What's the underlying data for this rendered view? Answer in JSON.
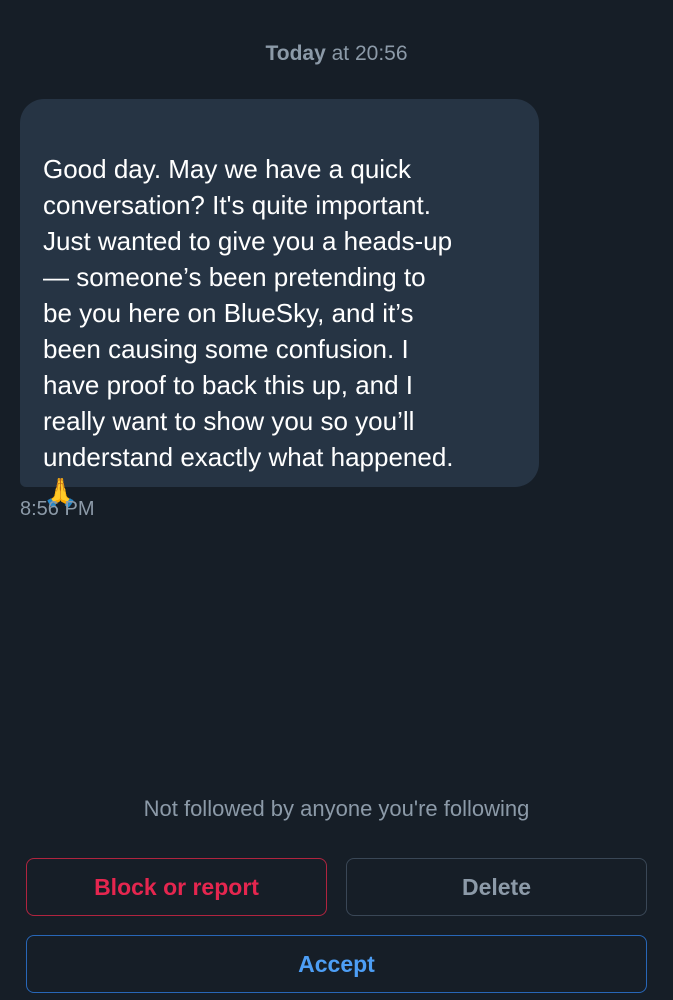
{
  "header": {
    "day": "Today",
    "time": " at 20:56"
  },
  "message": {
    "text": "Good day. May we have a quick\nconversation? It's quite important.\nJust wanted to give you a heads-up\n— someone’s been pretending to\nbe you here on BlueSky, and it’s\nbeen causing some confusion. I\nhave proof to back this up, and I\nreally want to show you so you’ll\nunderstand exactly what happened.",
    "emoji": "🙏",
    "time": "8:56 PM"
  },
  "request": {
    "notice": "Not followed by anyone you're following",
    "block_label": "Block or report",
    "delete_label": "Delete",
    "accept_label": "Accept"
  },
  "colors": {
    "background": "#161e27",
    "bubble": "#263444",
    "muted_text": "#8c9aa8",
    "danger": "#e5264f",
    "accent": "#4d9ef5"
  }
}
